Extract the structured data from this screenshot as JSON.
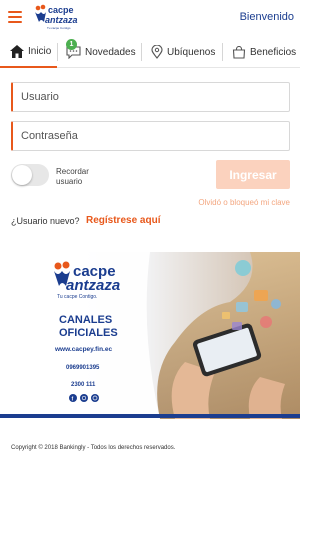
{
  "header": {
    "logo_name": "cacpe",
    "logo_name_2": "antzaza",
    "logo_tagline": "Tu cacpe Contigo",
    "welcome": "Bienvenido"
  },
  "tabs": [
    {
      "label": "Inicio",
      "icon": "home-icon",
      "active": true
    },
    {
      "label": "Novedades",
      "icon": "chat-icon",
      "badge": "1"
    },
    {
      "label": "Ubíquenos",
      "icon": "location-icon"
    },
    {
      "label": "Beneficios",
      "icon": "bag-icon"
    }
  ],
  "form": {
    "user_placeholder": "Usuario",
    "pass_placeholder": "Contraseña",
    "remember_label": "Recordar usuario",
    "login_button": "Ingresar",
    "forgot_link": "Olvidó o bloqueó mi clave",
    "new_user_text": "¿Usuario nuevo?",
    "register_link": "Regístrese aquí"
  },
  "banner": {
    "brand_1": "cacpe",
    "brand_2": "antzaza",
    "tagline": "Tu cacpe Contigo.",
    "headline_1": "CANALES",
    "headline_2": "OFICIALES",
    "website": "www.cacpey.fin.ec",
    "phone_1": "0969901395",
    "phone_2": "2300 111",
    "accent_color": "#1b3d8f"
  },
  "footer": {
    "copyright": "Copyright © 2018 Bankingly - Todos los derechos reservados."
  },
  "colors": {
    "accent": "#e8581b",
    "brand_blue": "#1b3d8f",
    "button_disabled": "#fbd2be"
  }
}
